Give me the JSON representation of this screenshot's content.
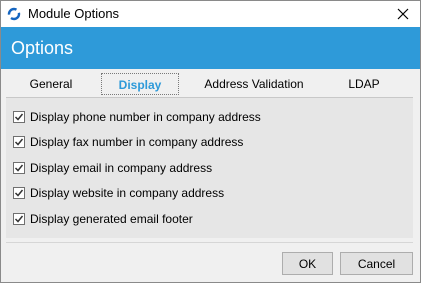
{
  "window": {
    "title": "Module Options"
  },
  "header": {
    "title": "Options"
  },
  "tabs": [
    {
      "label": "General",
      "active": false
    },
    {
      "label": "Display",
      "active": true
    },
    {
      "label": "Address Validation",
      "active": false
    },
    {
      "label": "LDAP",
      "active": false
    }
  ],
  "options": [
    {
      "label": "Display phone number in company address",
      "checked": true
    },
    {
      "label": "Display fax number in company address",
      "checked": true
    },
    {
      "label": "Display email in company address",
      "checked": true
    },
    {
      "label": "Display website in company address",
      "checked": true
    },
    {
      "label": "Display generated email footer",
      "checked": true
    }
  ],
  "buttons": {
    "ok": "OK",
    "cancel": "Cancel"
  },
  "colors": {
    "accent": "#2e9ad9",
    "panel": "#e6e6e6",
    "window": "#f0f0f0"
  }
}
